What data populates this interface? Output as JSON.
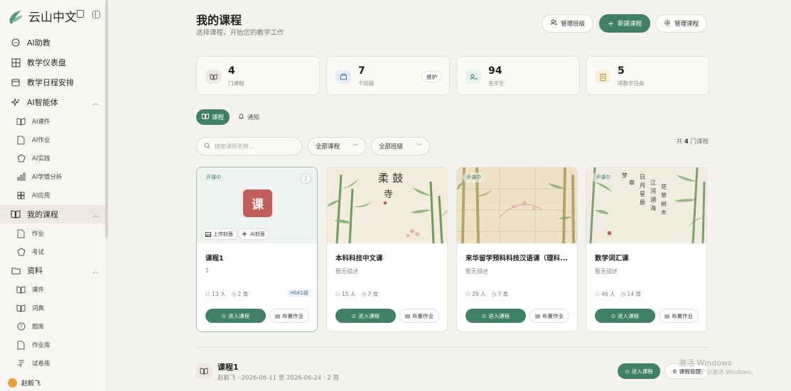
{
  "app": {
    "brand": "云山中文",
    "brand_icon": "yunshan-logo-icon"
  },
  "sidebar": {
    "items": [
      {
        "label": "AI助教",
        "icon": "chat-bubble-icon"
      },
      {
        "label": "教学仪表盘",
        "icon": "dashboard-grid-icon"
      },
      {
        "label": "教学日程安排",
        "icon": "calendar-icon"
      },
      {
        "label": "AI智能体",
        "icon": "sparkle-icon",
        "expanded": true
      },
      {
        "label": "AI课件",
        "icon": "book-icon"
      },
      {
        "label": "AI作业",
        "icon": "doc-icon"
      },
      {
        "label": "AI实践",
        "icon": "shield-icon"
      },
      {
        "label": "AI学情分析",
        "icon": "bar-chart-icon"
      },
      {
        "label": "AI应用",
        "icon": "apps-icon"
      },
      {
        "label": "我的课程",
        "icon": "book-icon",
        "expanded": true,
        "active": true
      },
      {
        "label": "作业",
        "icon": "doc-icon"
      },
      {
        "label": "考试",
        "icon": "shield-icon"
      },
      {
        "label": "资料",
        "icon": "folder-icon",
        "expanded": true
      },
      {
        "label": "课件",
        "icon": "book-icon"
      },
      {
        "label": "词典",
        "icon": "book-icon"
      },
      {
        "label": "题库",
        "icon": "question-icon"
      },
      {
        "label": "作业库",
        "icon": "doc-icon"
      },
      {
        "label": "试卷库",
        "icon": "paper-icon"
      }
    ],
    "user": "赵毅飞"
  },
  "header": {
    "title": "我的课程",
    "subtitle": "选择课程，开始您的教学工作",
    "btn_manage_class": "管理班级",
    "btn_new_course": "新建课程",
    "btn_manage_course": "管理课程"
  },
  "stats": [
    {
      "value": "4",
      "caption": "门课程",
      "icon": "book-icon"
    },
    {
      "value": "7",
      "caption": "个班级",
      "icon": "building-icon",
      "tag": "维护"
    },
    {
      "value": "94",
      "caption": "名学生",
      "icon": "users-icon"
    },
    {
      "value": "5",
      "caption": "项教学任务",
      "icon": "clipboard-icon"
    }
  ],
  "tabs": {
    "courses": "课程",
    "notices": "通知"
  },
  "filters": {
    "search_placeholder": "搜索课程名称...",
    "course_filter": "全部课程",
    "class_filter": "全部班级",
    "count_prefix": "共",
    "count_value": "4",
    "count_suffix": "门课程"
  },
  "courses": [
    {
      "title": "课程1",
      "desc": "1",
      "status": "开课中",
      "cover_char": "课",
      "students": "13 人",
      "weeks": "2 周",
      "level": "HSK1级",
      "upload_cover": "上传封面",
      "ai_cover": "AI封面"
    },
    {
      "title": "本科科技中文课",
      "desc": "暂无描述",
      "status": "开课中",
      "students": "15 人",
      "weeks": "7 周"
    },
    {
      "title": "来华留学预科科技汉语课（理科...",
      "desc": "暂无描述",
      "status": "开课中",
      "students": "29 人",
      "weeks": "7 周"
    },
    {
      "title": "数学词汇课",
      "desc": "暂无描述",
      "status": "开课中",
      "students": "46 人",
      "weeks": "14 周"
    }
  ],
  "card_actions": {
    "enter": "进入课程",
    "assign": "布置作业"
  },
  "course_row": {
    "title": "课程1",
    "subtitle": "赵毅飞 · 2026-06-11 至 2026-06-24 · 2 周",
    "enter": "进入课程",
    "manage": "课程管理"
  },
  "watermark": {
    "line1": "激活 Windows",
    "line2": "转到\"设置\"以激活 Windows。"
  },
  "colors": {
    "accent": "#3f8067",
    "course_badge": "#c15e5b",
    "background": "#f4f2ec"
  }
}
